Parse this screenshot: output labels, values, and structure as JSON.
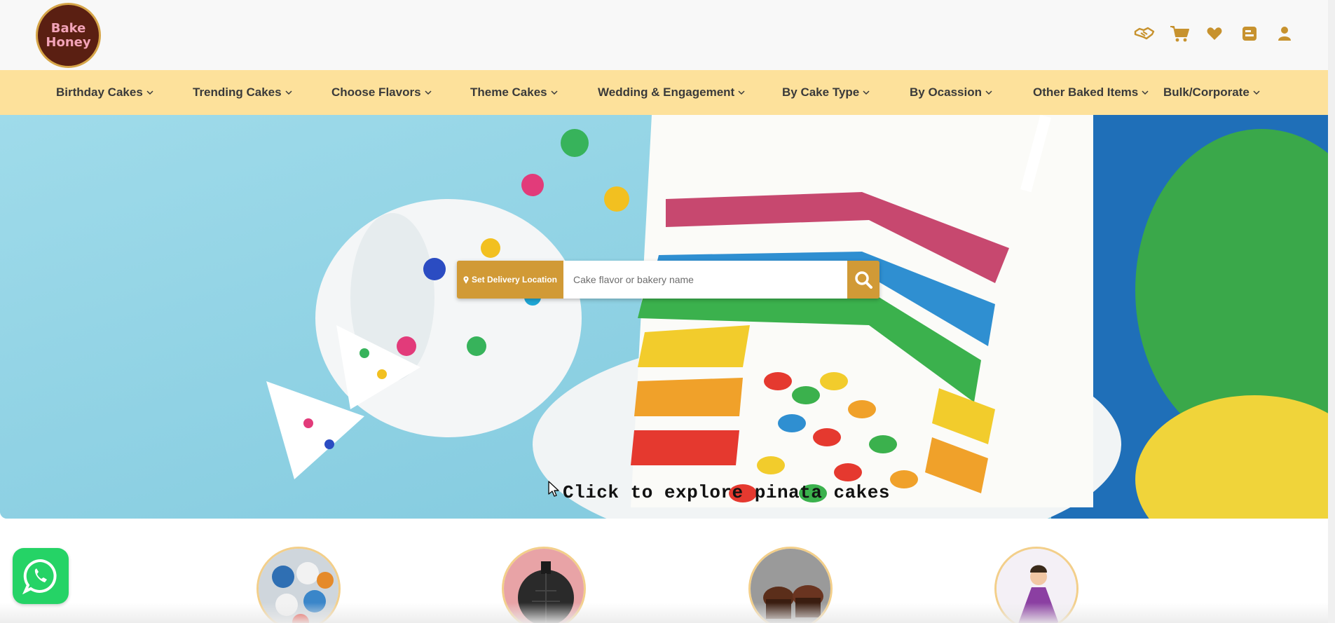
{
  "brand": {
    "logo_line1": "Bake",
    "logo_line2": "Honey"
  },
  "header_icons": [
    "handshake-icon",
    "cart-icon",
    "heart-icon",
    "orders-icon",
    "user-icon"
  ],
  "nav": {
    "items": [
      "Birthday Cakes",
      "Trending Cakes",
      "Choose Flavors",
      "Theme Cakes",
      "Wedding & Engagement",
      "By Cake Type",
      "By Ocassion",
      "Other Baked Items",
      "Bulk/Corporate"
    ]
  },
  "hero": {
    "location_button": "Set Delivery Location",
    "search_placeholder": "Cake flavor or bakery name",
    "explore_text": "Click to explore pinata cakes"
  },
  "categories": [
    "cupcakes-box",
    "bomb-cake",
    "chocolate-cupcakes",
    "princess-doll-cake"
  ],
  "colors": {
    "accent": "#d19a36",
    "nav_bg": "#fde19b",
    "header_bg": "#f8f8f8",
    "whatsapp": "#25d366"
  }
}
